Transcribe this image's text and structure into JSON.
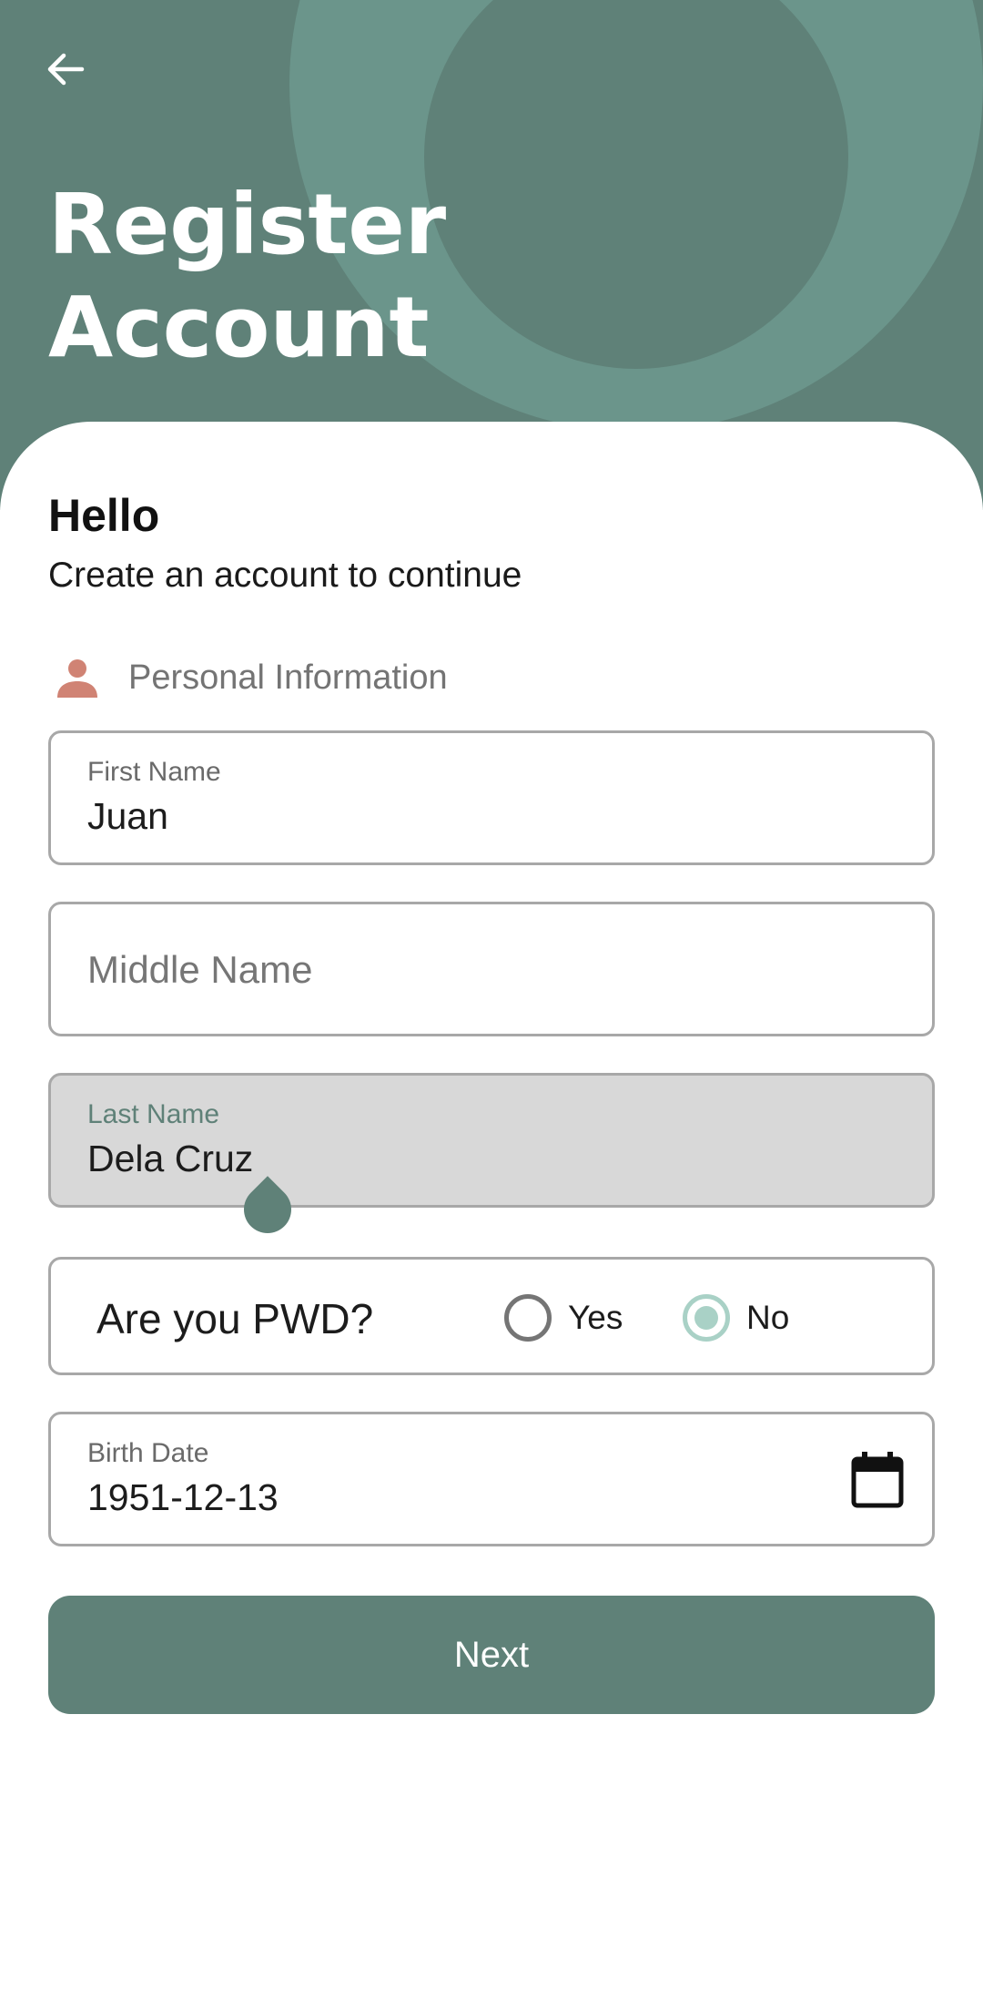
{
  "header": {
    "title_line1": "Register",
    "title_line2": "Account",
    "back_icon": "arrow-left-icon"
  },
  "intro": {
    "greeting": "Hello",
    "subtitle": "Create an account to continue"
  },
  "section": {
    "label": "Personal Information",
    "icon": "person-icon"
  },
  "fields": {
    "first_name": {
      "label": "First Name",
      "value": "Juan"
    },
    "middle_name": {
      "placeholder": "Middle Name",
      "value": ""
    },
    "last_name": {
      "label": "Last Name",
      "value": "Dela Cruz",
      "focused": true
    },
    "birth_date": {
      "label": "Birth Date",
      "value": "1951-12-13",
      "icon": "calendar-icon"
    }
  },
  "pwd": {
    "question": "Are you PWD?",
    "options": [
      "Yes",
      "No"
    ],
    "selected": "No"
  },
  "next_label": "Next",
  "colors": {
    "primary": "#5f8178",
    "header_ring": "#6b958b",
    "accent_person": "#d08374",
    "radio_selected": "#a9d1c6",
    "focused_field_bg": "#d8d8d8"
  }
}
